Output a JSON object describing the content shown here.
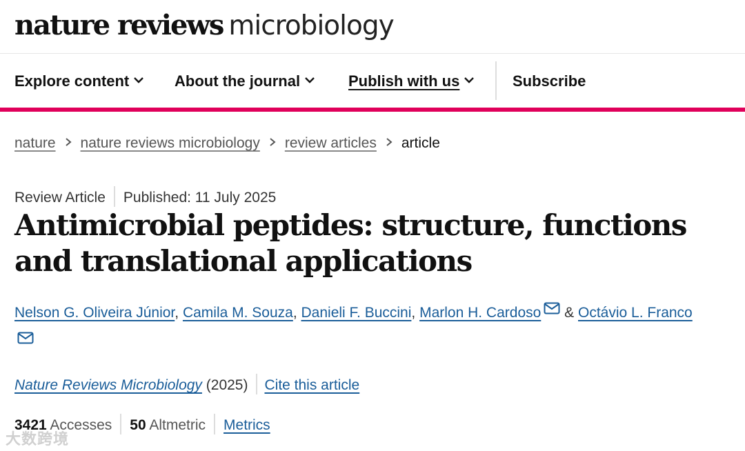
{
  "masthead": {
    "brand": "nature reviews",
    "journal": "microbiology"
  },
  "nav": {
    "items": [
      {
        "label": "Explore content"
      },
      {
        "label": "About the journal"
      },
      {
        "label": "Publish with us"
      }
    ],
    "subscribe_label": "Subscribe"
  },
  "breadcrumb": {
    "items": [
      "nature",
      "nature reviews microbiology",
      "review articles"
    ],
    "current": "article"
  },
  "article": {
    "type": "Review Article",
    "published": "Published: 11 July 2025",
    "title": "Antimicrobial peptides: structure, functions and translational applications",
    "authors": [
      "Nelson G. Oliveira Júnior",
      "Camila M. Souza",
      "Danieli F. Buccini",
      "Marlon H. Cardoso",
      "Octávio L. Franco"
    ],
    "author_sep": ", ",
    "author_and": " & ",
    "journal_name": "Nature Reviews Microbiology",
    "year": "(2025)",
    "cite_label": "Cite this article",
    "accesses_count": "3421",
    "accesses_label": "Accesses",
    "altmetric_count": "50",
    "altmetric_label": "Altmetric",
    "metrics_label": "Metrics"
  },
  "watermark": "大数跨境",
  "colors": {
    "accent": "#e0005a",
    "link": "#1a5d99"
  },
  "icons": {
    "dropdown": "chevron-down-icon",
    "breadcrumb_sep": "chevron-right-icon",
    "email": "envelope-icon"
  }
}
